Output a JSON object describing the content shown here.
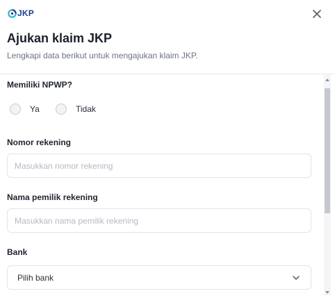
{
  "header": {
    "logo_text": "JKP",
    "title": "Ajukan klaim JKP",
    "subtitle": "Lengkapi data berikut untuk mengajukan klaim JKP."
  },
  "form": {
    "npwp": {
      "label": "Memiliki NPWP?",
      "options": [
        "Ya",
        "Tidak"
      ]
    },
    "account_number": {
      "label": "Nomor rekening",
      "placeholder": "Masukkan nomor rekening",
      "value": ""
    },
    "account_name": {
      "label": "Nama pemilik rekening",
      "placeholder": "Masukkan nama pemilik rekening",
      "value": ""
    },
    "bank": {
      "label": "Bank",
      "selected": "Pilih bank"
    }
  },
  "colors": {
    "brand": "#1c3f94",
    "brand_accent": "#34b8c9",
    "text_primary": "#1f2430",
    "text_muted": "#6b7380",
    "border": "#e1e4e8"
  },
  "icons": [
    "jkp-logo-icon",
    "close-icon",
    "chevron-down-icon"
  ]
}
